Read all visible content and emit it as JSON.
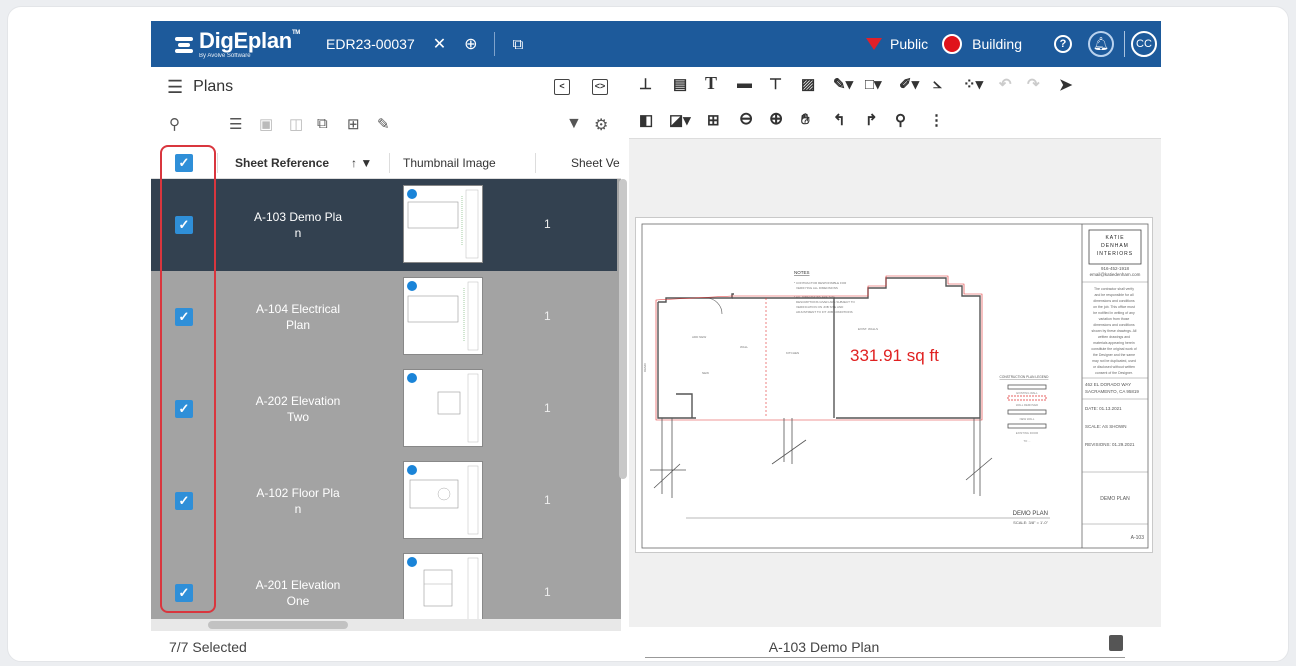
{
  "header": {
    "app_name": "DigEplan",
    "app_tm": "TM",
    "app_sub": "By Avolve Software",
    "doc_id": "EDR23-00037",
    "filter_label": "Public",
    "layer_label": "Building",
    "avatar_initials": "CC",
    "colors": {
      "bar": "#1d5a9b",
      "accent_red": "#e0131b"
    }
  },
  "left_panel": {
    "title": "Plans",
    "columns": [
      "Sheet Reference",
      "Thumbnail Image",
      "Sheet Ve"
    ],
    "rows": [
      {
        "name": "A-103 Demo Pla\nn",
        "version": "1",
        "selected": true
      },
      {
        "name": "A-104 Electrical\nPlan",
        "version": "1",
        "selected": false
      },
      {
        "name": "A-202 Elevation\nTwo",
        "version": "1",
        "selected": false
      },
      {
        "name": "A-102 Floor Pla\nn",
        "version": "1",
        "selected": false
      },
      {
        "name": "A-201 Elevation\nOne",
        "version": "1",
        "selected": false
      }
    ],
    "status": "7/7 Selected"
  },
  "viewer": {
    "measurement": "331.91 sq ft",
    "title_block": {
      "company": "KATIE\nDENHAM\nINTERIORS",
      "phone": "916-452-1918",
      "email": "email@katiedenham.com",
      "address": "462 EL DORADO WAY\nSACRAMENTO, CA 95819",
      "date": "DATE: 01.13.2021",
      "scale": "SCALE: AS SHOWN",
      "revisions": "REVISIONS: 01.29.2021",
      "sheet_name": "DEMO PLAN",
      "sheet_number": "A-103"
    },
    "plan_label": "DEMO PLAN",
    "plan_scale": "SCALE: 3/8\" = 1'-0\"",
    "notes_title": "NOTES",
    "legend_title": "CONSTRUCTION PLAN LEGEND",
    "bottom_title": "A-103 Demo Plan"
  }
}
